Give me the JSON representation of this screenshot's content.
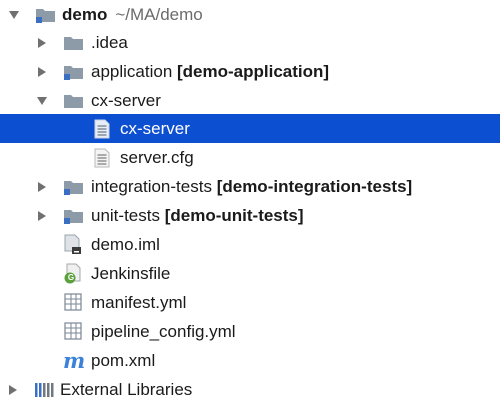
{
  "project": {
    "name": "demo",
    "path": "~/MA/demo"
  },
  "items": {
    "idea": {
      "name": ".idea"
    },
    "application": {
      "name": "application",
      "module": "[demo-application]"
    },
    "cx_server_folder": {
      "name": "cx-server"
    },
    "cx_server_file": {
      "name": "cx-server"
    },
    "server_cfg": {
      "name": "server.cfg"
    },
    "integration_tests": {
      "name": "integration-tests",
      "module": "[demo-integration-tests]"
    },
    "unit_tests": {
      "name": "unit-tests",
      "module": "[demo-unit-tests]"
    },
    "demo_iml": {
      "name": "demo.iml"
    },
    "jenkinsfile": {
      "name": "Jenkinsfile",
      "badge": "G"
    },
    "manifest": {
      "name": "manifest.yml"
    },
    "pipeline_config": {
      "name": "pipeline_config.yml"
    },
    "pom": {
      "name": "pom.xml",
      "badge": "m"
    }
  },
  "external_libraries": {
    "name": "External Libraries"
  },
  "colors": {
    "selection": "#0d4fd1",
    "folder": "#8d9aa8",
    "module_marker": "#3b6fc4",
    "jenkins_badge": "#5aa03c",
    "maven": "#3b82d8"
  }
}
